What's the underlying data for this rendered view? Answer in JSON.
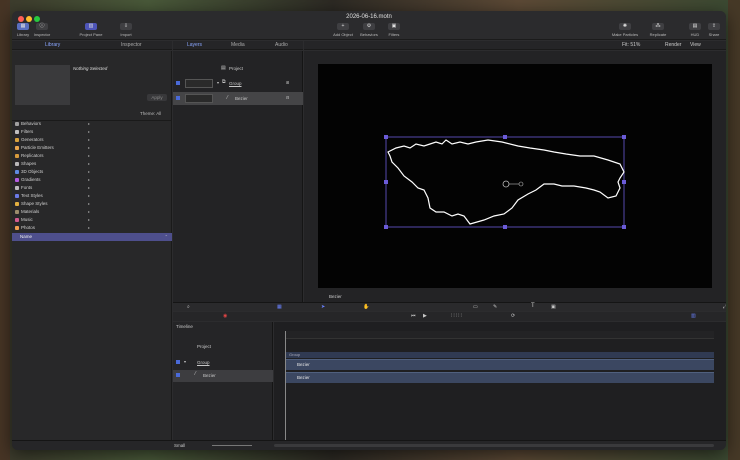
{
  "window": {
    "title": "2026-06-16.motn"
  },
  "toolbar": {
    "library": "Library",
    "inspector": "Inspector",
    "project_pane": "Project Pane",
    "import": "Import",
    "add_object": "Add Object",
    "behaviors": "Behaviors",
    "filters": "Filters",
    "make_particles": "Make Particles",
    "replicate": "Replicate",
    "hud": "HUD",
    "share": "Share"
  },
  "left_tabs": [
    "Library",
    "Inspector"
  ],
  "center_tabs": [
    "Layers",
    "Media",
    "Audio"
  ],
  "library": {
    "nothing_selected": "Nothing Selected",
    "apply": "Apply",
    "theme": "Theme: All",
    "items": [
      {
        "label": "Behaviors",
        "color": "#9f9f9f"
      },
      {
        "label": "Filters",
        "color": "#bfbfbf"
      },
      {
        "label": "Generators",
        "color": "#d7a33d"
      },
      {
        "label": "Particle Emitters",
        "color": "#e8a84e"
      },
      {
        "label": "Replicators",
        "color": "#d59b3c"
      },
      {
        "label": "Shapes",
        "color": "#b8b8b8"
      },
      {
        "label": "3D Objects",
        "color": "#5f8be0"
      },
      {
        "label": "Gradients",
        "color": "#b55ce2"
      },
      {
        "label": "Fonts",
        "color": "#bdbdbd"
      },
      {
        "label": "Text Styles",
        "color": "#6a7be6"
      },
      {
        "label": "Shape Styles",
        "color": "#e0b040"
      },
      {
        "label": "Materials",
        "color": "#9b8d6b"
      },
      {
        "label": "Music",
        "color": "#d15b90"
      },
      {
        "label": "Photos",
        "color": "#f0a050"
      }
    ],
    "name_header": "Name"
  },
  "layers": {
    "project": "Project",
    "group": "Group",
    "bezier": "Bezier"
  },
  "canvas": {
    "fit": "Fit: 51%",
    "render": "Render",
    "view": "View",
    "selected_label": "Bezier"
  },
  "timeline": {
    "label": "Timeline",
    "project": "Project",
    "group": "Group",
    "bezier": "Bezier",
    "group_bar": "Group",
    "bezier_bar1": "Bezier",
    "bezier_bar2": "Bezier"
  },
  "footer": {
    "size": "Small"
  }
}
